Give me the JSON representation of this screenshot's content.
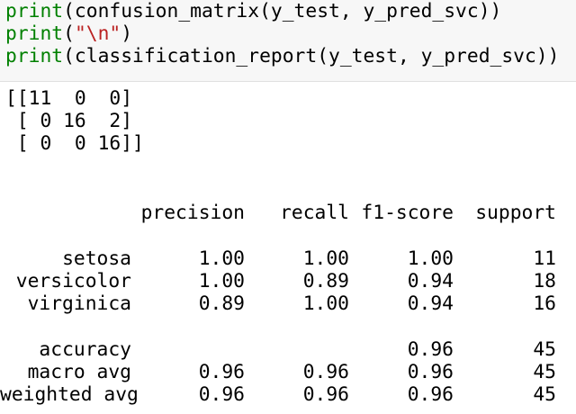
{
  "code": {
    "line1": {
      "fn": "print",
      "rest": "(confusion_matrix(y_test, y_pred_svc))"
    },
    "line2": {
      "fn": "print",
      "open": "(",
      "string": "\"\\n\"",
      "close": ")"
    },
    "line3": {
      "fn": "print",
      "rest": "(classification_report(y_test, y_pred_svc))"
    }
  },
  "output": {
    "matrix_lines": [
      "[[11  0  0]",
      " [ 0 16  2]",
      " [ 0  0 16]]"
    ],
    "report": {
      "headers": [
        "precision",
        "recall",
        "f1-score",
        "support"
      ],
      "rows": [
        {
          "label": "setosa",
          "precision": "1.00",
          "recall": "1.00",
          "f1": "1.00",
          "support": "11"
        },
        {
          "label": "versicolor",
          "precision": "1.00",
          "recall": "0.89",
          "f1": "0.94",
          "support": "18"
        },
        {
          "label": "virginica",
          "precision": "0.89",
          "recall": "1.00",
          "f1": "0.94",
          "support": "16"
        }
      ],
      "summary": [
        {
          "label": "accuracy",
          "precision": "",
          "recall": "",
          "f1": "0.96",
          "support": "45"
        },
        {
          "label": "macro avg",
          "precision": "0.96",
          "recall": "0.96",
          "f1": "0.96",
          "support": "45"
        },
        {
          "label": "weighted avg",
          "precision": "0.96",
          "recall": "0.96",
          "f1": "0.96",
          "support": "45"
        }
      ]
    }
  },
  "colors": {
    "keyword": "#008000",
    "string": "#ba2121",
    "code_background": "#f7f7f7"
  }
}
